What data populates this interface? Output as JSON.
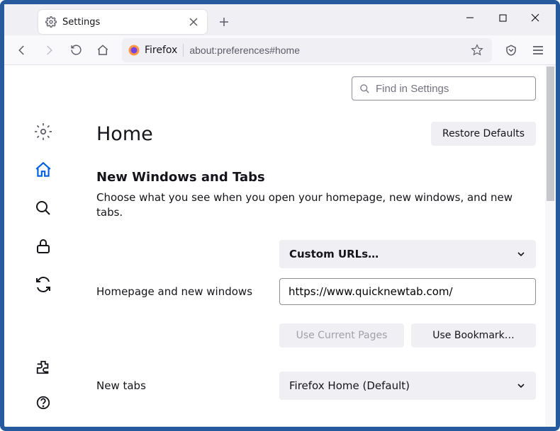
{
  "tab": {
    "title": "Settings"
  },
  "urlbar": {
    "identity": "Firefox",
    "url": "about:preferences#home"
  },
  "search": {
    "placeholder": "Find in Settings"
  },
  "page": {
    "title": "Home",
    "restore_button": "Restore Defaults",
    "section_title": "New Windows and Tabs",
    "section_desc": "Choose what you see when you open your homepage, new windows, and new tabs."
  },
  "homepage": {
    "label": "Homepage and new windows",
    "select_value": "Custom URLs…",
    "url_value": "https://www.quicknewtab.com/",
    "use_current": "Use Current Pages",
    "use_bookmark": "Use Bookmark…"
  },
  "newtabs": {
    "label": "New tabs",
    "select_value": "Firefox Home (Default)"
  }
}
